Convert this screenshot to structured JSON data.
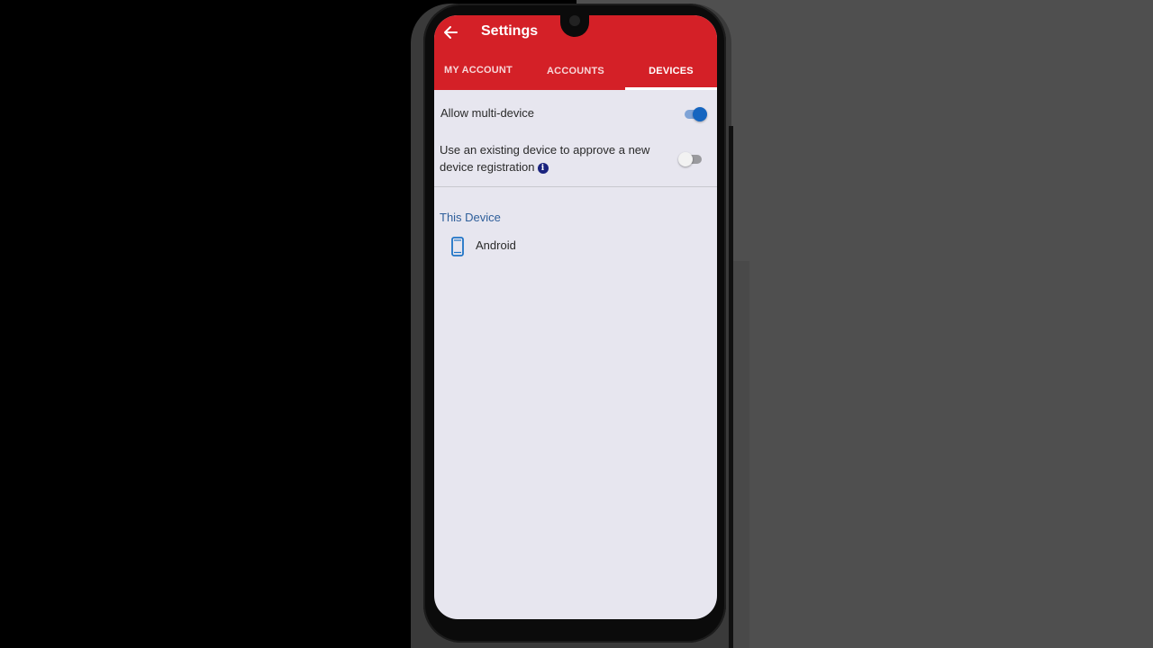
{
  "header": {
    "title": "Settings",
    "back_icon": "arrow-left-icon",
    "color": "#d42027"
  },
  "tabs": [
    {
      "label": "MY ACCOUNT",
      "active": false
    },
    {
      "label": "ACCOUNTS",
      "active": false
    },
    {
      "label": "DEVICES",
      "active": true
    }
  ],
  "settings": {
    "multi_device": {
      "label": "Allow multi-device",
      "enabled": true
    },
    "approve_registration": {
      "label_line1": "Use an existing device to approve a new",
      "label_line2": "device registration",
      "enabled": false,
      "info_icon": "info-icon"
    }
  },
  "this_device": {
    "section_title": "This Device",
    "device_name": "Android",
    "device_icon": "smartphone-icon"
  },
  "colors": {
    "accent": "#1565c0",
    "section_header": "#2e5e9a"
  }
}
